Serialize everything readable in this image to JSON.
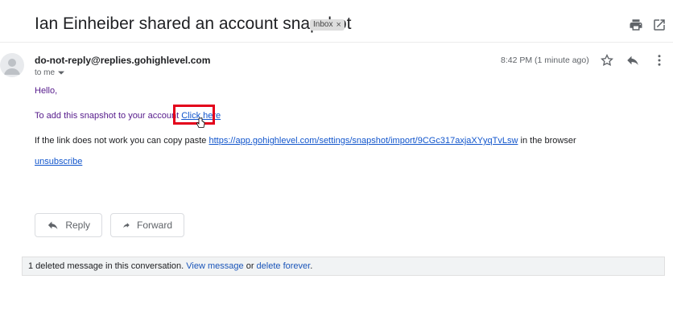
{
  "header": {
    "subject": "Ian Einheiber shared an account snapshot",
    "label": "Inbox",
    "label_remove": "×",
    "icons": [
      "print-icon",
      "open-in-new-window-icon"
    ]
  },
  "message": {
    "sender": "do-not-reply@replies.gohighlevel.com",
    "recipient_summary": "to me",
    "time": "8:42 PM (1 minute ago)",
    "icons": [
      "star-icon",
      "reply-icon",
      "more-vert-icon",
      "avatar-icon"
    ],
    "greeting": "Hello,",
    "line1_prefix": "To add this snapshot to your account",
    "line1_link": "Click here",
    "line2_prefix": "If the link does not work you can copy paste",
    "line2_link": "https://app.gohighlevel.com/settings/snapshot/import/9CGc317axjaXYyqTvLsw",
    "line2_suffix": "in the browser",
    "unsubscribe": "unsubscribe"
  },
  "actions": {
    "reply_label": "Reply",
    "forward_label": "Forward"
  },
  "conversation": {
    "deleted_text": "1 deleted message in this conversation.",
    "view_link": "View message",
    "or_text": "or",
    "delete_link": "delete forever",
    "period": "."
  },
  "colors": {
    "highlight_box": "#e3001b",
    "link": "#1155cc",
    "visited_text": "#551a8b"
  }
}
